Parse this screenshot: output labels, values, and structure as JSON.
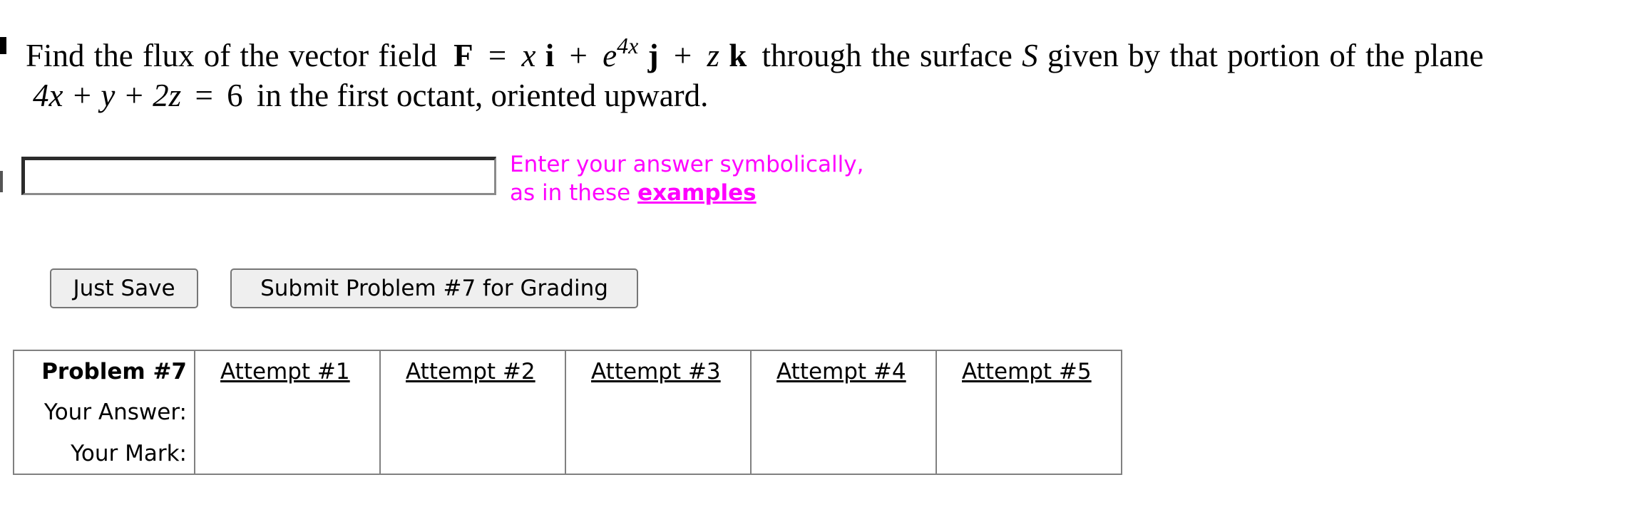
{
  "question": {
    "line1": {
      "intro": "Find the flux of the vector field",
      "F": "F",
      "eq": "=",
      "x": "x",
      "i": "i",
      "plus1": "+",
      "e": "e",
      "exp": "4x",
      "j": "j",
      "plus2": "+",
      "z": "z",
      "k": "k",
      "tail": "through the surface",
      "S": "S",
      "tail2": "given by that portion of the plane"
    },
    "line2": {
      "plane": "4x + y + 2z",
      "eq": "=",
      "rhs": "6",
      "tail": "in the first octant, oriented upward."
    }
  },
  "answer": {
    "value": "",
    "hint_line1": "Enter your answer symbolically,",
    "hint_line2": "as in these",
    "hint_link": "examples"
  },
  "buttons": {
    "save": "Just Save",
    "submit": "Submit Problem #7 for Grading"
  },
  "attempts_table": {
    "header": "Problem #7",
    "attempts": [
      "Attempt #1",
      "Attempt #2",
      "Attempt #3",
      "Attempt #4",
      "Attempt #5"
    ],
    "row_labels": [
      "Your Answer:",
      "Your Mark:"
    ]
  }
}
